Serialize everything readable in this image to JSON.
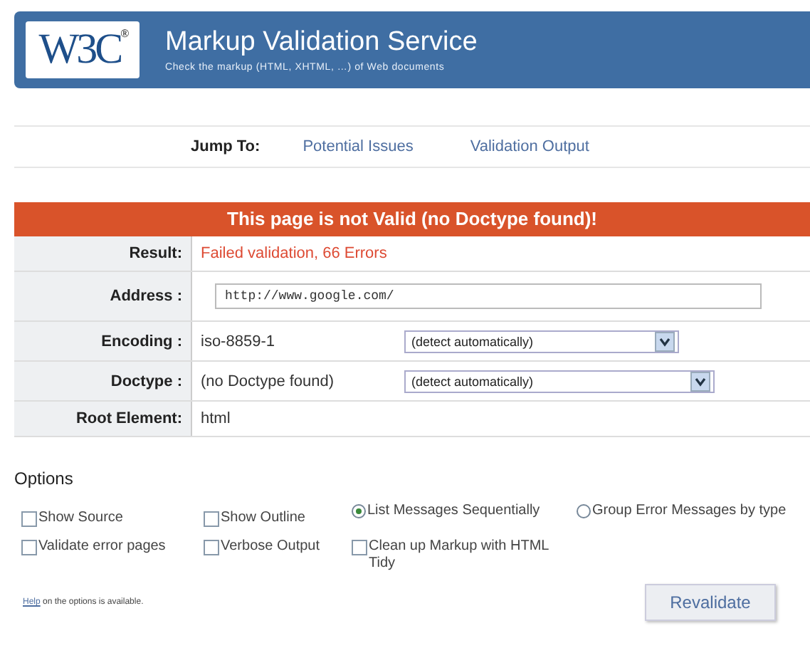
{
  "header": {
    "logo": "W3C",
    "registered_mark": "®",
    "title": "Markup Validation Service",
    "subtitle": "Check the markup (HTML, XHTML, …) of Web documents"
  },
  "jump": {
    "label": "Jump To:",
    "links": [
      "Potential Issues",
      "Validation Output"
    ]
  },
  "banner": "This page is not Valid (no Doctype found)!",
  "results": [
    {
      "kind": "text",
      "label": "Result:",
      "value": "Failed validation, 66 Errors",
      "error": true
    },
    {
      "kind": "input",
      "label": "Address :",
      "value": "http://www.google.com/"
    },
    {
      "kind": "select",
      "label": "Encoding :",
      "value": "iso-8859-1",
      "select": "(detect automatically)"
    },
    {
      "kind": "select",
      "label": "Doctype :",
      "value": "(no Doctype found)",
      "select": "(detect automatically)"
    },
    {
      "kind": "text",
      "label": "Root Element:",
      "value": "html",
      "error": false
    }
  ],
  "options": {
    "title": "Options",
    "rows": [
      [
        {
          "kind": "checkbox",
          "label": "Show Source",
          "checked": false
        },
        {
          "kind": "checkbox",
          "label": "Show Outline",
          "checked": false
        },
        {
          "kind": "radio",
          "label": "List Messages Sequentially",
          "selected": true
        },
        {
          "kind": "radio",
          "label": "Group Error Messages by type",
          "selected": false
        }
      ],
      [
        {
          "kind": "checkbox",
          "label": "Validate error pages",
          "checked": false
        },
        {
          "kind": "checkbox",
          "label": "Verbose Output",
          "checked": false
        },
        {
          "kind": "checkbox",
          "label": "Clean up Markup with HTML Tidy",
          "checked": false
        }
      ]
    ],
    "help_link": "Help",
    "help_text": "on the options is available.",
    "button": "Revalidate"
  }
}
